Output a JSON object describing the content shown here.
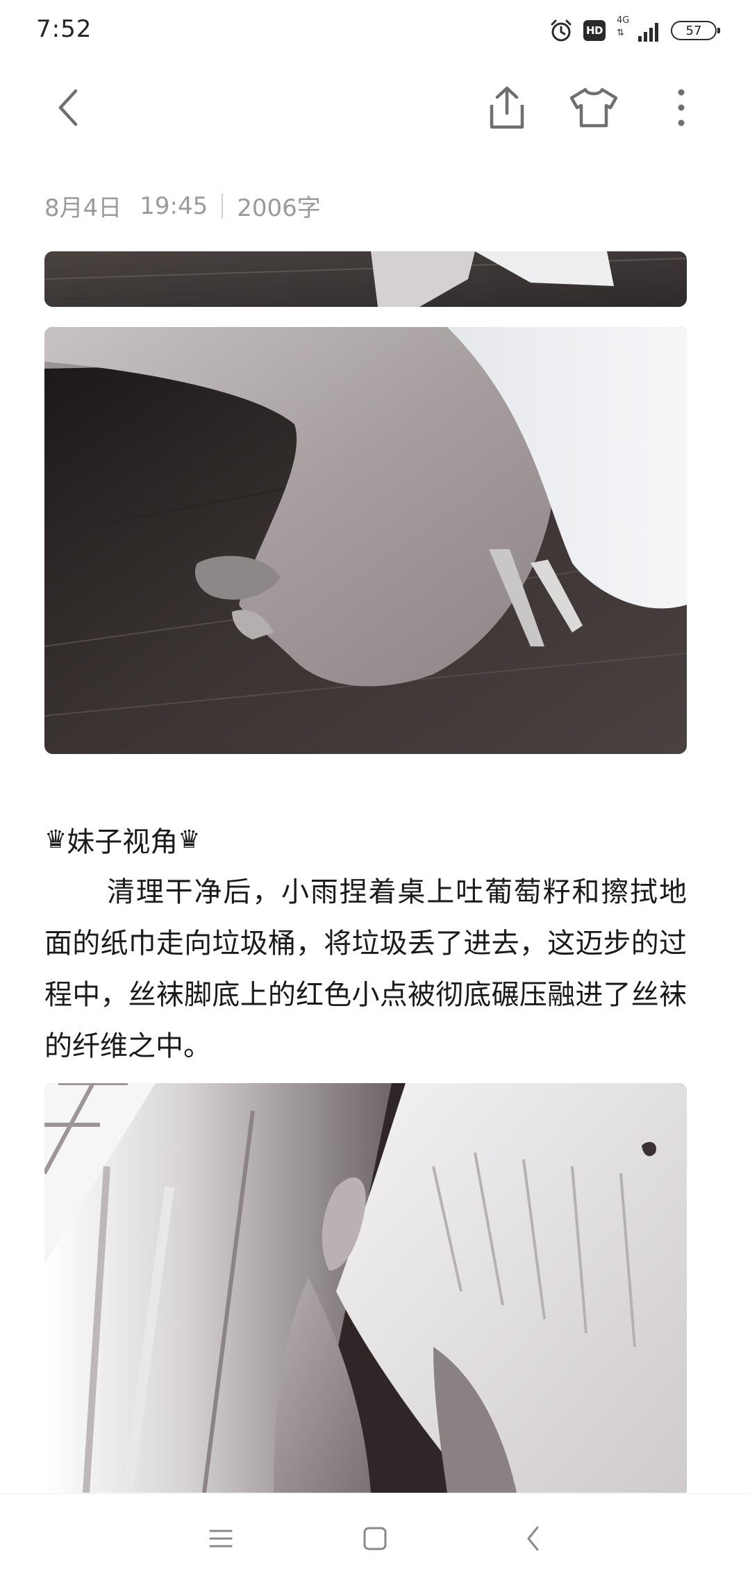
{
  "status_bar": {
    "time": "7:52",
    "hd_label": "HD",
    "network_type": "4G",
    "network_arrows": "⇅",
    "battery_level": "57",
    "icons": [
      "alarm-icon",
      "hd-icon",
      "signal-icon",
      "battery-icon"
    ]
  },
  "toolbar": {
    "icons": [
      "back-chevron-icon",
      "share-icon",
      "shirt-theme-icon",
      "more-vertical-icon"
    ]
  },
  "note": {
    "date": "8月4日",
    "time": "19:45",
    "word_count": "2006字",
    "section_title": "妹子视角",
    "crown_glyph": "♛",
    "paragraph": "清理干净后，小雨捏着桌上吐葡萄籽和擦拭地面的纸巾走向垃圾桶，将垃圾丢了进去，这迈步的过程中，丝袜脚底上的红色小点被彻底碾压融进了丝袜的纤维之中。"
  },
  "nav_bar": {
    "icons": [
      "menu-icon",
      "home-square-icon",
      "back-icon"
    ]
  },
  "colors": {
    "meta_text": "#9a9a9a",
    "body_text": "#1a1a1a",
    "icon_gray": "#6f6f6f"
  }
}
